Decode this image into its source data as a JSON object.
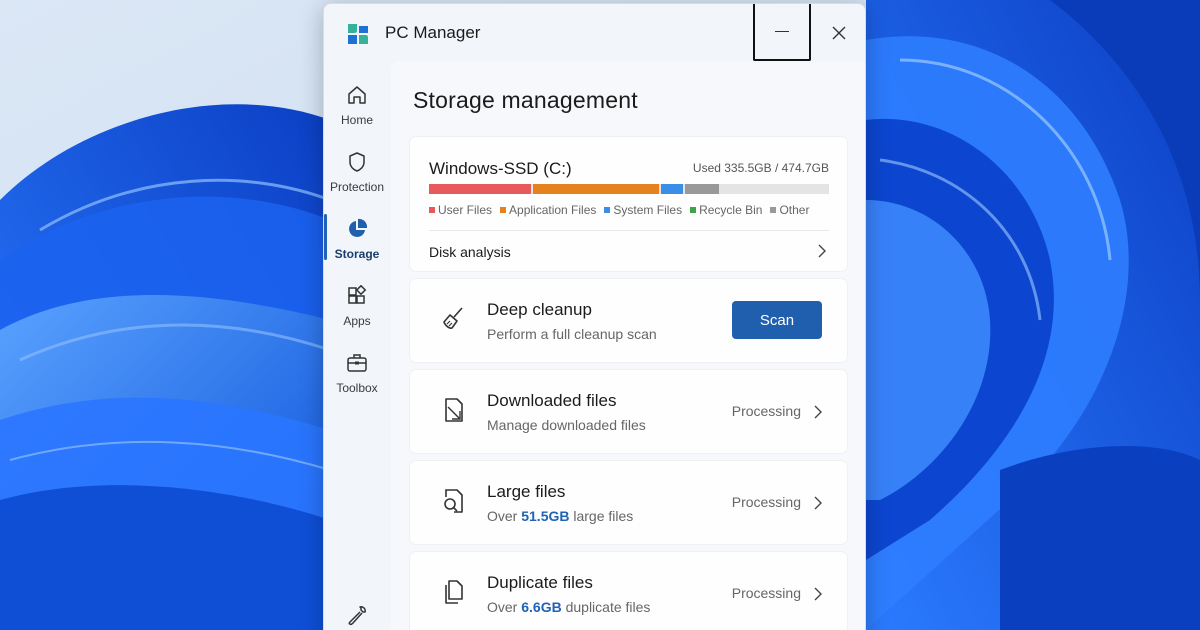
{
  "window": {
    "title": "PC Manager"
  },
  "sidebar": {
    "items": [
      {
        "label": "Home",
        "icon": "home-icon"
      },
      {
        "label": "Protection",
        "icon": "shield-icon"
      },
      {
        "label": "Storage",
        "icon": "pie-chart-icon",
        "active": true
      },
      {
        "label": "Apps",
        "icon": "apps-icon"
      },
      {
        "label": "Toolbox",
        "icon": "toolbox-icon"
      }
    ],
    "settings_icon": "wrench-icon"
  },
  "page": {
    "title": "Storage management"
  },
  "disk": {
    "name": "Windows-SSD (C:)",
    "usage_text": "Used 335.5GB / 474.7GB",
    "used_gb": 335.5,
    "total_gb": 474.7,
    "categories": [
      {
        "label": "User Files",
        "color": "#e8595c",
        "fraction": 0.255
      },
      {
        "label": "Application Files",
        "color": "#e6821e",
        "fraction": 0.315
      },
      {
        "label": "System Files",
        "color": "#3b8ee8",
        "fraction": 0.055
      },
      {
        "label": "Recycle Bin",
        "color": "#3aa646",
        "fraction": 0.0
      },
      {
        "label": "Other",
        "color": "#999999",
        "fraction": 0.085
      }
    ],
    "analysis_label": "Disk analysis"
  },
  "deep_cleanup": {
    "title": "Deep cleanup",
    "subtitle": "Perform a full cleanup scan",
    "button": "Scan"
  },
  "downloaded": {
    "title": "Downloaded files",
    "subtitle": "Manage downloaded files",
    "status": "Processing"
  },
  "large": {
    "title": "Large files",
    "sub_prefix": "Over ",
    "size": "51.5GB",
    "sub_suffix": " large files",
    "status": "Processing"
  },
  "duplicate": {
    "title": "Duplicate files",
    "sub_prefix": "Over ",
    "size": "6.6GB",
    "sub_suffix": " duplicate files",
    "status": "Processing"
  },
  "colors": {
    "accent": "#1f5fae",
    "highlight": "#1f62b7"
  }
}
